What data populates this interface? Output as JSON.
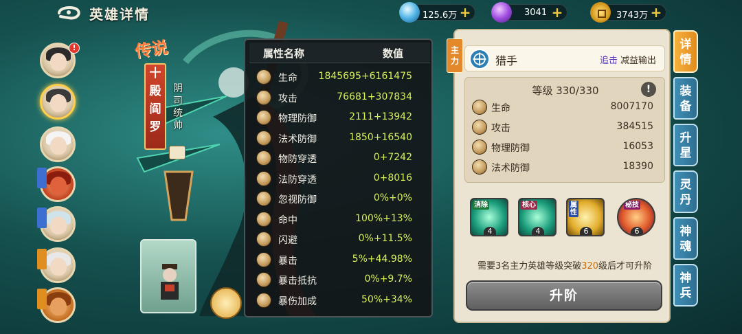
{
  "header": {
    "title": "英雄详情",
    "currencies": [
      {
        "id": "gem",
        "value": "125.6万",
        "icon": "gem-icon"
      },
      {
        "id": "orb",
        "value": "3041",
        "icon": "orb-icon"
      },
      {
        "id": "coin",
        "value": "3743万",
        "icon": "coin-icon"
      }
    ],
    "plus": "+"
  },
  "hero_list": {
    "badge": "!"
  },
  "hero": {
    "rarity": "传说",
    "name_chars": [
      "十",
      "殿",
      "阎",
      "罗"
    ],
    "title": "阴司统帅"
  },
  "attributes": {
    "header_name": "属性名称",
    "header_value": "数值",
    "rows": [
      {
        "name": "生命",
        "base": "1845695",
        "bonus": "+6161475"
      },
      {
        "name": "攻击",
        "base": "76681",
        "bonus": "+307834"
      },
      {
        "name": "物理防御",
        "base": "2111",
        "bonus": "+13942"
      },
      {
        "name": "法术防御",
        "base": "1850",
        "bonus": "+16540"
      },
      {
        "name": "物防穿透",
        "base": "0",
        "bonus": "+7242"
      },
      {
        "name": "法防穿透",
        "base": "0",
        "bonus": "+8016"
      },
      {
        "name": "忽视防御",
        "base": "0%",
        "bonus": "+0%"
      },
      {
        "name": "命中",
        "base": "100%",
        "bonus": "+13%"
      },
      {
        "name": "闪避",
        "base": "0%",
        "bonus": "+11.5%"
      },
      {
        "name": "暴击",
        "base": "5%",
        "bonus": "+44.98%"
      },
      {
        "name": "暴击抵抗",
        "base": "0%",
        "bonus": "+9.7%"
      },
      {
        "name": "暴伤加成",
        "base": "50%",
        "bonus": "+34%"
      }
    ]
  },
  "detail": {
    "main_tag": "主力",
    "class_name": "猎手",
    "tag_chase": "追击",
    "tag_debuff": "减益输出",
    "level": "等级 330/330",
    "info": "!",
    "stats": [
      {
        "name": "生命",
        "value": "8007170"
      },
      {
        "name": "攻击",
        "value": "384515"
      },
      {
        "name": "物理防御",
        "value": "16053"
      },
      {
        "name": "法术防御",
        "value": "18390"
      }
    ],
    "skills": [
      {
        "label": "消除",
        "level": "4",
        "style": "green"
      },
      {
        "label": "核心",
        "level": "4",
        "style": "green"
      },
      {
        "label": "属性",
        "level": "6",
        "style": "gold"
      },
      {
        "label": "秘技",
        "level": "6",
        "style": "red"
      }
    ],
    "requirement_pre": "需要3名主力英雄等级突破",
    "requirement_num": "320",
    "requirement_post": "级后才可升阶",
    "upgrade_label": "升阶"
  },
  "tabs": [
    {
      "label": "详情",
      "active": true
    },
    {
      "label": "装备",
      "active": false
    },
    {
      "label": "升星",
      "active": false
    },
    {
      "label": "灵丹",
      "active": false
    },
    {
      "label": "神魂",
      "active": false
    },
    {
      "label": "神兵",
      "active": false
    }
  ]
}
